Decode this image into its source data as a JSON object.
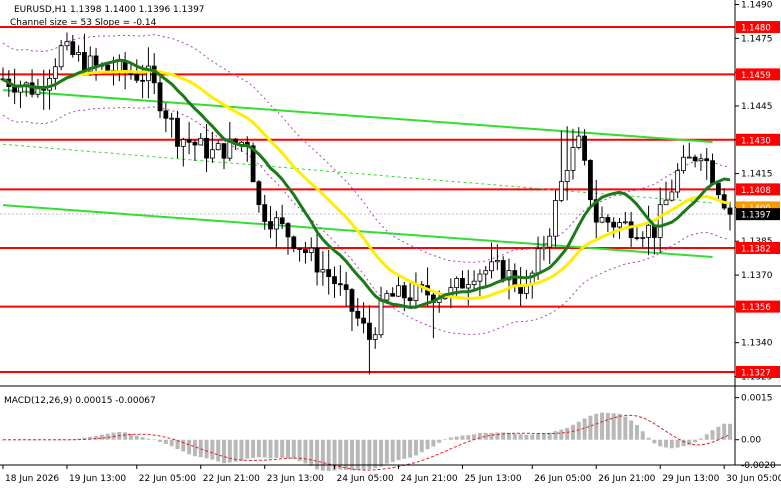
{
  "header": {
    "symbol_line": "EURUSD,H1  1.1398 1.1400 1.1396 1.1397",
    "channel_line": "Channel size = 53 Slope = -0.14"
  },
  "chart_data": {
    "type": "candlestick",
    "main_panel": {
      "ylim": [
        1.1323,
        1.1492
      ],
      "price_ticks": [
        "1.1490",
        "1.1475",
        "1.1460",
        "1.1445",
        "1.1430",
        "1.1415",
        "1.1400",
        "1.1385",
        "1.1370",
        "1.1355",
        "1.1340",
        "1.1325"
      ],
      "horizontal_levels": [
        {
          "value": 1.148,
          "label": "1.1480",
          "color": "#ff0000"
        },
        {
          "value": 1.1459,
          "label": "1.1459",
          "color": "#ff0000"
        },
        {
          "value": 1.143,
          "label": "1.1430",
          "color": "#ff0000"
        },
        {
          "value": 1.1408,
          "label": "1.1408",
          "color": "#ff0000"
        },
        {
          "value": 1.1382,
          "label": "1.1382",
          "color": "#ff0000"
        },
        {
          "value": 1.1356,
          "label": "1.1356",
          "color": "#ff0000"
        },
        {
          "value": 1.1327,
          "label": "1.1327",
          "color": "#ff0000"
        }
      ],
      "current_price": {
        "value": 1.1397,
        "label": "1.1397",
        "color": "#000000"
      },
      "ask_price": {
        "value": 1.14,
        "label": "1.1400",
        "color": "#ff9900"
      },
      "channel_lines": [
        {
          "from": [
            0,
            1.1452
          ],
          "to": [
            122,
            1.1429
          ],
          "color": "#33dd33"
        },
        {
          "from": [
            0,
            1.1401
          ],
          "to": [
            122,
            1.1378
          ],
          "color": "#33dd33"
        }
      ],
      "channel_mid": {
        "from": [
          0,
          1.1428
        ],
        "to": [
          122,
          1.1402
        ],
        "color": "#33dd33"
      },
      "candles": [],
      "ma_fast_color": "#1a7a1a",
      "ma_slow_color": "#ffee00",
      "bands_color": "#b040c0"
    },
    "macd_panel": {
      "title": "MACD(12,26,9) 0.00015 -0.00067",
      "ylim": [
        -0.0009,
        0.0017
      ],
      "ticks": [
        "0.0015",
        "0.00",
        "-0.0020"
      ],
      "histogram": [],
      "signal": []
    },
    "x_labels": [
      "18 Jun 2026",
      "19 Jun 13:00",
      "22 Jun 05:00",
      "22 Jun 21:00",
      "23 Jun 13:00",
      "24 Jun 05:00",
      "24 Jun 21:00",
      "25 Jun 13:00",
      "26 Jun 05:00",
      "26 Jun 21:00",
      "29 Jun 13:00",
      "30 Jun 05:00"
    ],
    "x_label_bars": [
      0,
      11,
      23,
      34,
      45,
      57,
      68,
      79,
      91,
      102,
      113,
      124
    ]
  }
}
